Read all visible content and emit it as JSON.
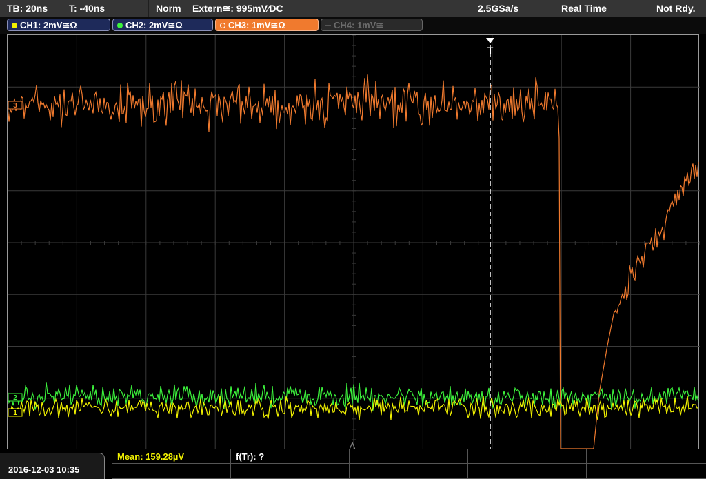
{
  "status_bar": {
    "timebase": "TB: 20ns",
    "trigger_offset": "T: -40ns",
    "trigger_mode": "Norm",
    "trigger_source": "Extern≅: 995mV∕DC",
    "sample_rate": "2.5GSa/s",
    "acquisition": "Real Time",
    "status": "Not Rdy."
  },
  "channels": [
    {
      "label": "CH1: 2mV≅Ω",
      "color": "#f2f200",
      "active": true
    },
    {
      "label": "CH2: 2mV≅Ω",
      "color": "#3cf23c",
      "active": true
    },
    {
      "label": "CH3: 1mV≅Ω",
      "color": "#f07a2e",
      "active": true,
      "selected": true
    },
    {
      "label": "CH4: 1mV≅",
      "color": "#6b6b6b",
      "active": false
    }
  ],
  "marker_labels": {
    "trigger": "T",
    "ch3_marker": "3",
    "ch2_marker": "2",
    "ch1_marker": "1"
  },
  "measurements": {
    "mean": "Mean: 159.28µV",
    "frequency": "f(Tr): ?"
  },
  "datetime": "2016-12-03 10:35",
  "colors": {
    "ch1": "#f2f200",
    "ch2": "#3cf23c",
    "ch3": "#f07a2e",
    "grid": "#3a3a3a"
  }
}
